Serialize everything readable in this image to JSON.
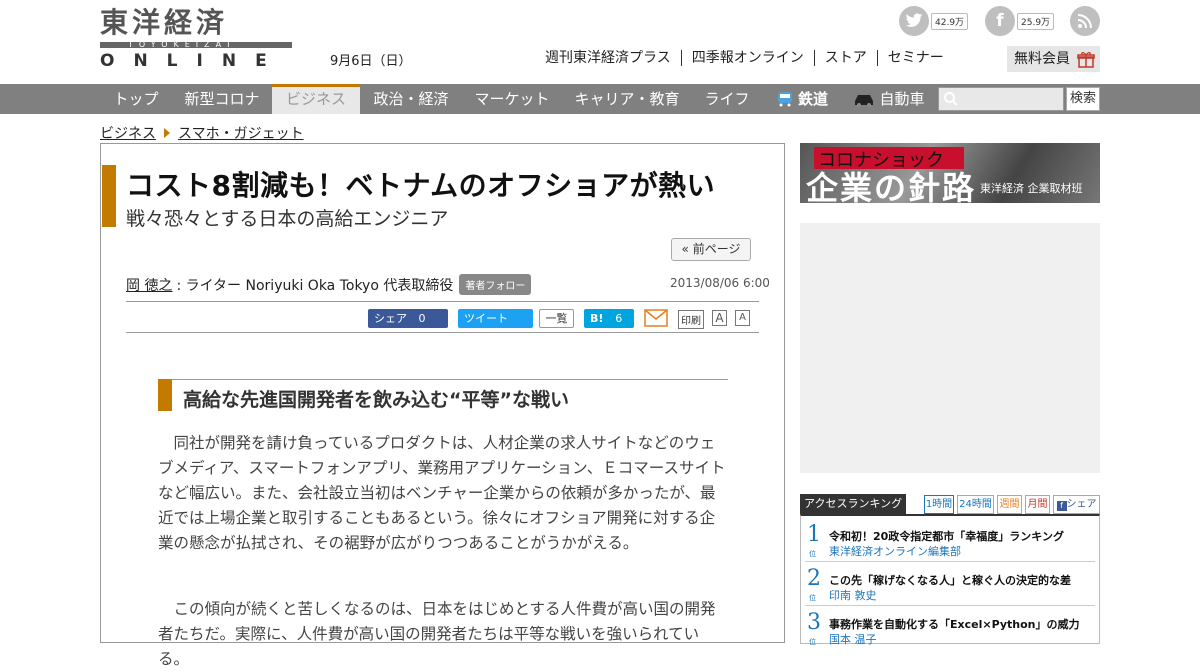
{
  "header": {
    "logo_kanji": "東洋経済",
    "logo_sub": "TOYOKEIZAI",
    "logo_online": "ONLINE",
    "date": "9月6日（日）",
    "links": [
      "週刊東洋経済プラス",
      "四季報オンライン",
      "ストア",
      "セミナー"
    ],
    "member_label": "無料会員",
    "twitter_count": "42.9万",
    "facebook_count": "25.9万"
  },
  "nav": {
    "items": [
      "トップ",
      "新型コロナ",
      "ビジネス",
      "政治・経済",
      "マーケット",
      "キャリア・教育",
      "ライフ",
      "鉄道",
      "自動車"
    ],
    "search_button": "検索"
  },
  "breadcrumb": [
    "ビジネス",
    "スマホ・ガジェット"
  ],
  "article": {
    "title": "コスト8割減も！ベトナムのオフショアが熱い",
    "subtitle": "戦々恐々とする日本の高給エンジニア",
    "prev_page": "« 前ページ",
    "author_name": "岡 徳之",
    "author_role": ": ライター Noriyuki Oka Tokyo 代表取締役",
    "follow_label": "著者フォロー",
    "pubdate": "2013/08/06 6:00",
    "share": {
      "fb_label": "シェア",
      "fb_count": "0",
      "tw_label": "ツイート",
      "list_label": "一覧",
      "hb_label": "B!",
      "hb_count": "6",
      "print_label": "印刷",
      "font_large": "A",
      "font_small": "A"
    },
    "section_heading": "高給な先進国開発者を飲み込む“平等”な戦い",
    "paragraph1": "同社が開発を請け負っているプロダクトは、人材企業の求人サイトなどのウェブメディア、スマートフォンアプリ、業務用アプリケーション、Ｅコマースサイトなど幅広い。また、会社設立当初はベンチャー企業からの依頼が多かったが、最近では上場企業と取引することもあるという。徐々にオフショア開発に対する企業の懸念が払拭され、その裾野が広がりつつあることがうかがえる。",
    "paragraph2": "この傾向が続くと苦しくなるのは、日本をはじめとする人件費が高い国の開発者たちだ。実際に、人件費が高い国の開発者たちは平等な戦いを強いられている。"
  },
  "sidebar": {
    "banner_top": "コロナショック",
    "banner_main": "企業の針路",
    "banner_credit": "東洋経済 企業取材班",
    "ranking_title": "アクセスランキング",
    "ranking_tabs": [
      "1時間",
      "24時間",
      "週間",
      "月間",
      "シェア"
    ],
    "ranking": [
      {
        "num": "1",
        "unit": "位",
        "title": "令和初！20政令指定都市「幸福度」ランキング",
        "author": "東洋経済オンライン編集部"
      },
      {
        "num": "2",
        "unit": "位",
        "title": "この先「稼げなくなる人」と稼ぐ人の決定的な差",
        "author": "印南 敦史"
      },
      {
        "num": "3",
        "unit": "位",
        "title": "事務作業を自動化する「Excel×Python」の威力",
        "author": "国本 温子"
      }
    ]
  },
  "colors": {
    "accent": "#c47a00",
    "nav_bg": "#808080",
    "link_blue": "#1a75bb"
  }
}
